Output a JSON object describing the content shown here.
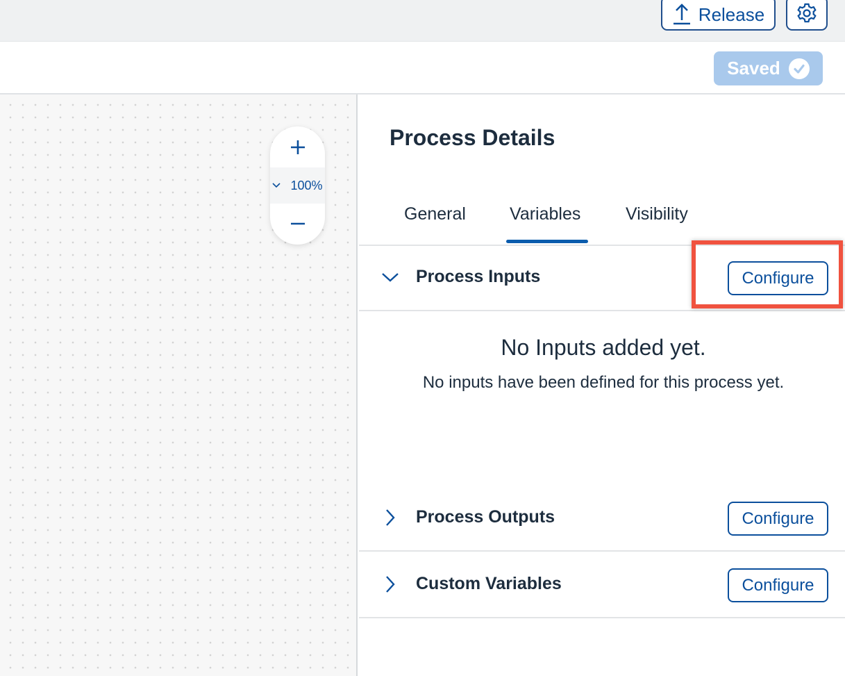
{
  "header": {
    "release_label": "Release",
    "release_icon": "upload-icon",
    "settings_icon": "gear-icon",
    "saved_label": "Saved",
    "saved_icon": "check-circle-icon"
  },
  "canvas": {
    "zoom_level": "100%",
    "zoom_in_icon": "plus-icon",
    "zoom_out_icon": "minus-icon"
  },
  "panel": {
    "title": "Process Details",
    "tabs": [
      {
        "label": "General",
        "selected": false
      },
      {
        "label": "Variables",
        "selected": true
      },
      {
        "label": "Visibility",
        "selected": false
      }
    ],
    "sections": [
      {
        "title": "Process Inputs",
        "expanded": true,
        "button": "Configure"
      },
      {
        "title": "Process Outputs",
        "expanded": false,
        "button": "Configure"
      },
      {
        "title": "Custom Variables",
        "expanded": false,
        "button": "Configure"
      }
    ],
    "empty_state": {
      "title": "No Inputs added yet.",
      "description": "No inputs have been defined for this process yet."
    }
  },
  "colors": {
    "accent": "#0b4f9c",
    "highlight": "#f0523f",
    "saved_bg": "#a9c9ec"
  }
}
